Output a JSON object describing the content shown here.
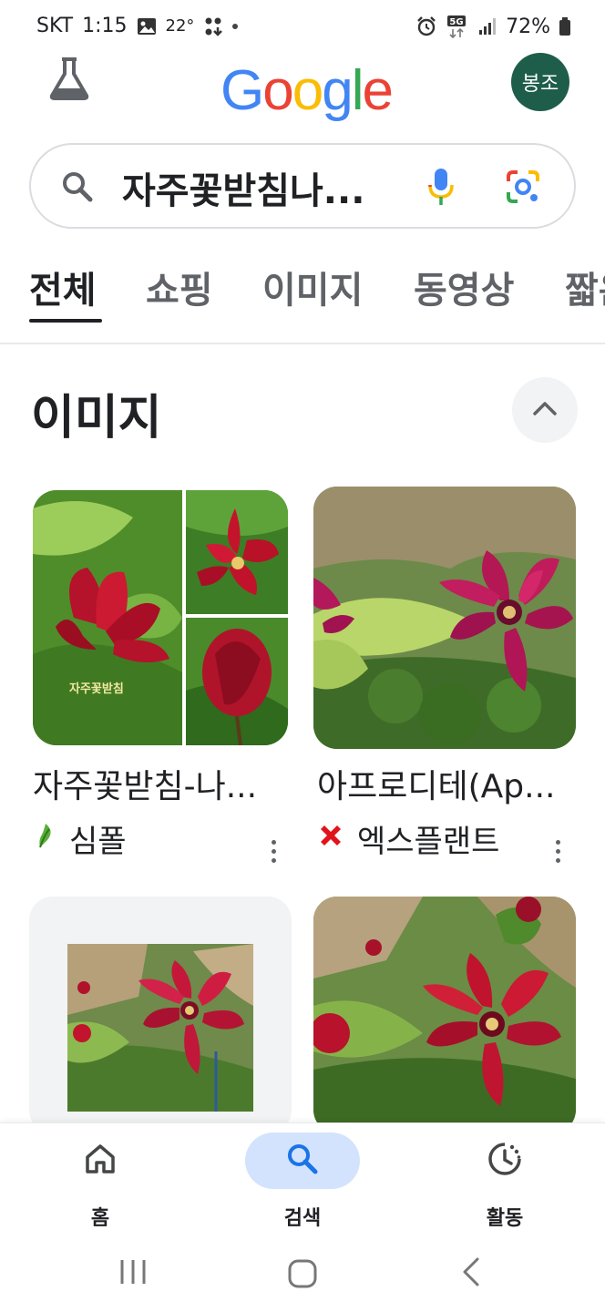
{
  "status_bar": {
    "carrier": "SKT",
    "time": "1:15",
    "temperature": "22°",
    "network": "5G",
    "battery": "72%"
  },
  "header": {
    "logo_letters": [
      "G",
      "o",
      "o",
      "g",
      "l",
      "e"
    ],
    "logo_colors": [
      "#4285F4",
      "#EA4335",
      "#FBBC05",
      "#4285F4",
      "#34A853",
      "#EA4335"
    ],
    "avatar_text": "봉조",
    "avatar_color": "#1e5d4a"
  },
  "search": {
    "query": "자주꽃받침나..."
  },
  "tabs": [
    {
      "label": "전체",
      "active": true
    },
    {
      "label": "쇼핑",
      "active": false
    },
    {
      "label": "이미지",
      "active": false
    },
    {
      "label": "동영상",
      "active": false
    },
    {
      "label": "짧은",
      "active": false
    }
  ],
  "images_section": {
    "title": "이미지",
    "results": [
      {
        "title": "자주꽃받침-나...",
        "source": "심폴",
        "watermark": "자주꽃받침",
        "source_icon": "leaf-icon"
      },
      {
        "title": "아프로디테(Ap...",
        "source": "엑스플랜트",
        "source_icon": "red-x-icon"
      },
      {
        "title": "",
        "source": "",
        "source_icon": ""
      },
      {
        "title": "",
        "source": "",
        "source_icon": ""
      }
    ]
  },
  "bottom_nav": {
    "items": [
      {
        "label": "홈",
        "icon": "home-icon",
        "active": false
      },
      {
        "label": "검색",
        "icon": "search-icon",
        "active": true
      },
      {
        "label": "활동",
        "icon": "activity-icon",
        "active": false
      }
    ]
  },
  "colors": {
    "accent": "#1a73e8",
    "active_pill": "#d3e3fd",
    "flower_red": "#b5122b",
    "leaf_green": "#5a9e2f"
  }
}
